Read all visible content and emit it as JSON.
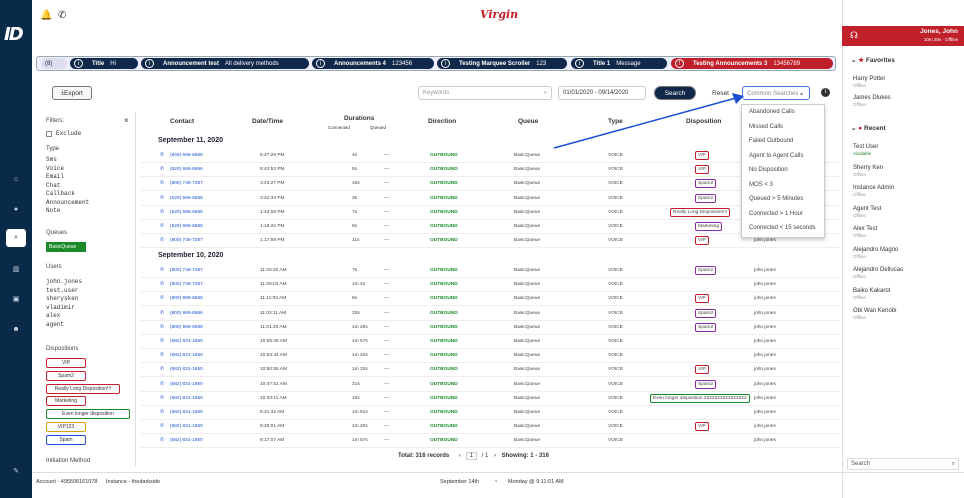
{
  "topbar": {
    "brand": "Virgin"
  },
  "ticker": [
    {
      "label": "(8)",
      "title": "",
      "msg": ""
    },
    {
      "title": "Title",
      "msg": "Hi"
    },
    {
      "title": "Announcement test",
      "msg": "All delivery methods"
    },
    {
      "title": "Announcements 4",
      "msg": "123456"
    },
    {
      "title": "Testing Marquee Scroller",
      "msg": "123"
    },
    {
      "title": "Title 1",
      "msg": "Message"
    },
    {
      "title": "Testing Announcements 3",
      "msg": "13456789"
    }
  ],
  "toolbar": {
    "export": "Export",
    "keywords_placeholder": "Keywords",
    "date_range": "01/01/2020 - 09/14/2020",
    "search": "Search",
    "reset": "Reset",
    "common_searches": "Common Searches"
  },
  "filters": {
    "title": "Filters:",
    "exclude": "Exclude",
    "type_label": "Type",
    "types": [
      "Sms",
      "Voice",
      "Email",
      "Chat",
      "Callback",
      "Announcement",
      "Note"
    ],
    "queues_label": "Queues",
    "queue_chip": "BasicQueue",
    "users_label": "Users",
    "users": [
      "john.jones",
      "test.user",
      "sherysken",
      "vladimir",
      "alex",
      "agent"
    ],
    "dispositions_label": "Dispositions",
    "dispositions": [
      "VIP",
      "Spam2",
      "Really Long Disposition!!!",
      "Marketing",
      "Even longer disposition",
      "VIP123",
      "Spam"
    ],
    "initiation": "Initiation Method"
  },
  "table": {
    "headers": {
      "contact": "Contact",
      "datetime": "Date/Time",
      "durations": "Durations",
      "connected": "Connected",
      "queued": "Queued",
      "direction": "Direction",
      "queue": "Queue",
      "type": "Type",
      "disposition": "Disposition"
    },
    "group1": "September 11, 2020",
    "group2": "September 10, 2020",
    "rows1": [
      {
        "contact": "(949) 666-6666",
        "time": "5:47:29 PM",
        "conn": "4s",
        "q": "—",
        "dir": "OUTBOUND",
        "queue": "BasicQueue",
        "type": "VOICE",
        "dispo": "VIP",
        "agent": ""
      },
      {
        "contact": "(520) 666-6666",
        "time": "5:43:53 PM",
        "conn": "5s",
        "q": "—",
        "dir": "OUTBOUND",
        "queue": "BasicQueue",
        "type": "VOICE",
        "dispo": "VIP",
        "agent": ""
      },
      {
        "contact": "(800) 746-7287",
        "time": "3:43:27 PM",
        "conn": "16s",
        "q": "—",
        "dir": "OUTBOUND",
        "queue": "BasicQueue",
        "type": "VOICE",
        "dispo": "Spam2",
        "agent": ""
      },
      {
        "contact": "(520) 666-6666",
        "time": "3:42:34 PM",
        "conn": "3s",
        "q": "—",
        "dir": "OUTBOUND",
        "queue": "BasicQueue",
        "type": "VOICE",
        "dispo": "Spam2",
        "agent": ""
      },
      {
        "contact": "(520) 666-6666",
        "time": "1:43:55 PM",
        "conn": "7s",
        "q": "—",
        "dir": "OUTBOUND",
        "queue": "BasicQueue",
        "type": "VOICE",
        "dispo": "Really Long Disposition!!!",
        "agent": ""
      },
      {
        "contact": "(520) 666-6666",
        "time": "1:18:22 PM",
        "conn": "8s",
        "q": "—",
        "dir": "OUTBOUND",
        "queue": "BasicQueue",
        "type": "VOICE",
        "dispo": "Marketing",
        "agent": ""
      },
      {
        "contact": "(800) 746-7287",
        "time": "1:17:58 PM",
        "conn": "11s",
        "q": "—",
        "dir": "OUTBOUND",
        "queue": "BasicQueue",
        "type": "VOICE",
        "dispo": "VIP",
        "agent": "john.jones"
      }
    ],
    "rows2": [
      {
        "contact": "(800) 746-7287",
        "time": "11:28:20 AM",
        "conn": "7s",
        "q": "—",
        "dir": "OUTBOUND",
        "queue": "BasicQueue",
        "type": "VOICE",
        "dispo": "Spam2",
        "agent": "john.jones"
      },
      {
        "contact": "(800) 746-7287",
        "time": "11:29:03 AM",
        "conn": "1m 4s",
        "q": "—",
        "dir": "OUTBOUND",
        "queue": "BasicQueue",
        "type": "VOICE",
        "dispo": "",
        "agent": "john.jones"
      },
      {
        "contact": "(800) 966-6566",
        "time": "11:11:03 AM",
        "conn": "6s",
        "q": "—",
        "dir": "OUTBOUND",
        "queue": "BasicQueue",
        "type": "VOICE",
        "dispo": "VIP",
        "agent": "john.jones"
      },
      {
        "contact": "(800) 966-6566",
        "time": "11:03:11 AM",
        "conn": "33s",
        "q": "—",
        "dir": "OUTBOUND",
        "queue": "BasicQueue",
        "type": "VOICE",
        "dispo": "Spam2",
        "agent": "john.jones"
      },
      {
        "contact": "(800) 966-6566",
        "time": "11:01:20 AM",
        "conn": "1m 26s",
        "q": "—",
        "dir": "OUTBOUND",
        "queue": "BasicQueue",
        "type": "VOICE",
        "dispo": "Spam2",
        "agent": "john.jones"
      },
      {
        "contact": "(682) 831-1650",
        "time": "10:55:45 AM",
        "conn": "1m 57s",
        "q": "—",
        "dir": "OUTBOUND",
        "queue": "BasicQueue",
        "type": "VOICE",
        "dispo": "",
        "agent": "john.jones"
      },
      {
        "contact": "(682) 831-1650",
        "time": "10:53:44 AM",
        "conn": "1m 22s",
        "q": "—",
        "dir": "OUTBOUND",
        "queue": "BasicQueue",
        "type": "VOICE",
        "dispo": "",
        "agent": "john.jones"
      },
      {
        "contact": "(682) 831-1650",
        "time": "10:50:55 AM",
        "conn": "1m 32s",
        "q": "—",
        "dir": "OUTBOUND",
        "queue": "BasicQueue",
        "type": "VOICE",
        "dispo": "VIP",
        "agent": "john.jones"
      },
      {
        "contact": "(682) 831-1650",
        "time": "10:47:51 AM",
        "conn": "31s",
        "q": "—",
        "dir": "OUTBOUND",
        "queue": "BasicQueue",
        "type": "VOICE",
        "dispo": "Spam2",
        "agent": "john.jones"
      },
      {
        "contact": "(682) 831-1650",
        "time": "10:33:11 AM",
        "conn": "10s",
        "q": "—",
        "dir": "OUTBOUND",
        "queue": "BasicQueue",
        "type": "VOICE",
        "dispo": "Even longer disposition 2222222222222222",
        "agent": "john.jones"
      },
      {
        "contact": "(682) 831-1650",
        "time": "8:21:32 AM",
        "conn": "1m 51s",
        "q": "—",
        "dir": "OUTBOUND",
        "queue": "BasicQueue",
        "type": "VOICE",
        "dispo": "",
        "agent": "john.jones"
      },
      {
        "contact": "(682) 831-1650",
        "time": "8:20:01 AM",
        "conn": "1m 20s",
        "q": "—",
        "dir": "OUTBOUND",
        "queue": "BasicQueue",
        "type": "VOICE",
        "dispo": "VIP",
        "agent": "john.jones"
      },
      {
        "contact": "(682) 831-1650",
        "time": "8:17:07 AM",
        "conn": "1m 57s",
        "q": "—",
        "dir": "OUTBOUND",
        "queue": "BasicQueue",
        "type": "VOICE",
        "dispo": "",
        "agent": "john.jones"
      }
    ],
    "pager": {
      "total": "Total: 316 records",
      "page": "1",
      "of": "/ 1",
      "showing": "Showing: 1 - 316"
    }
  },
  "dropdown": [
    "Abandoned Calls",
    "Missed Calls",
    "Failed Outbound",
    "Agent to Agent Calls",
    "No Disposition",
    "MOS < 3",
    "Queued > 5 Minutes",
    "Connected > 1 Hour",
    "Connected < 15 seconds"
  ],
  "right": {
    "user": "Jones, John",
    "status": "10m 28s · Offline",
    "favorites": "Favorites",
    "recent": "Recent",
    "search": "Search",
    "fav": [
      {
        "n": "Harry Potter",
        "s": "Offline"
      },
      {
        "n": "James Dlukes",
        "s": "Offline"
      }
    ],
    "rec": [
      {
        "n": "Test User",
        "s": "Available"
      },
      {
        "n": "Sherry Ken",
        "s": "Offline"
      },
      {
        "n": "Instance Admin",
        "s": "Offline"
      },
      {
        "n": "Agent Test",
        "s": "Offline"
      },
      {
        "n": "Alex Test",
        "s": "Offline"
      },
      {
        "n": "Alejandro Magno",
        "s": "Offline"
      },
      {
        "n": "Alejandro Dellucas",
        "s": "Offline"
      },
      {
        "n": "Baiko Kakarot",
        "s": "Offline"
      },
      {
        "n": "Obi Wan Kenobi",
        "s": "Offline"
      }
    ]
  },
  "footer": {
    "account": "Account - 495506161078",
    "instance": "Instance - thedarkside",
    "date": "September 14th",
    "time": "Monday @ 9:11:01 AM"
  }
}
